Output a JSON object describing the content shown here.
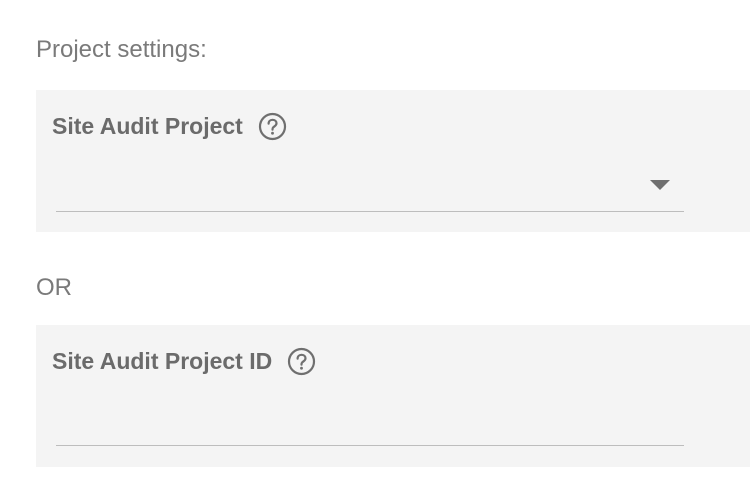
{
  "project_settings_label": "Project settings:",
  "site_audit_project": {
    "title": "Site Audit Project",
    "help_icon": "question-circle-icon",
    "selected_value": ""
  },
  "or_label": "OR",
  "site_audit_project_id": {
    "title": "Site Audit Project ID",
    "help_icon": "question-circle-icon",
    "value": ""
  },
  "colors": {
    "panel_bg": "#f4f4f4",
    "text": "#6b6b6b",
    "underline": "#bdbdbd"
  }
}
